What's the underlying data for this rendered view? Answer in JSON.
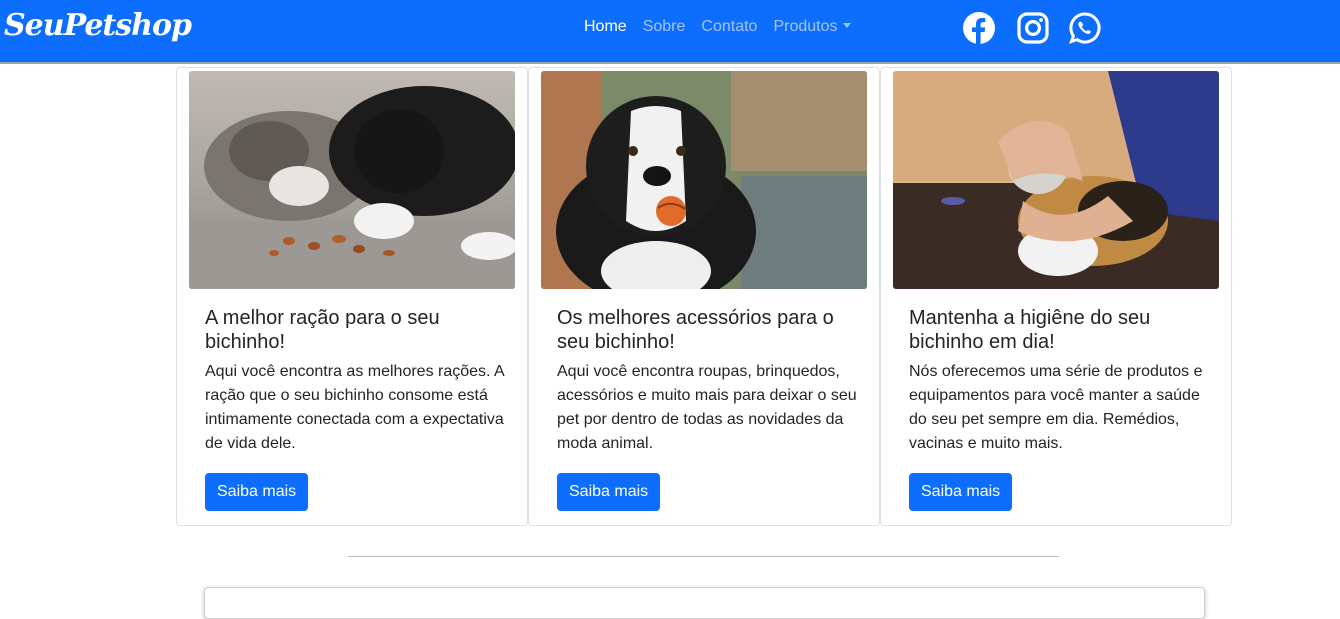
{
  "navbar": {
    "brand": "SeuPetshop",
    "links": [
      {
        "label": "Home",
        "active": true
      },
      {
        "label": "Sobre",
        "active": false
      },
      {
        "label": "Contato",
        "active": false
      },
      {
        "label": "Produtos",
        "active": false,
        "dropdown": true
      }
    ],
    "social_icons": [
      "facebook-icon",
      "instagram-icon",
      "whatsapp-icon"
    ],
    "background_color": "#0d6efd"
  },
  "cards": [
    {
      "image": "cats-eating-food-photo",
      "title": "A melhor ração para o seu bichinho!",
      "text": "Aqui você encontra as melhores rações. A ração que o seu bichinho consome está intimamente conectada com a expectativa de vida dele.",
      "button": "Saiba mais"
    },
    {
      "image": "dog-with-ball-photo",
      "title": "Os melhores acessórios para o seu bichinho!",
      "text": "Aqui você encontra roupas, brinquedos, acessórios e muito mais para deixar o seu pet por dentro de todas as novidades da moda animal.",
      "button": "Saiba mais"
    },
    {
      "image": "cat-vet-checkup-photo",
      "title": "Mantenha a higiêne do seu bichinho em dia!",
      "text": "Nós oferecemos uma série de produtos e equipamentos para você manter a saúde do seu pet sempre em dia. Remédios, vacinas e muito mais.",
      "button": "Saiba mais"
    }
  ],
  "colors": {
    "primary": "#0d6efd",
    "text": "#212529"
  }
}
